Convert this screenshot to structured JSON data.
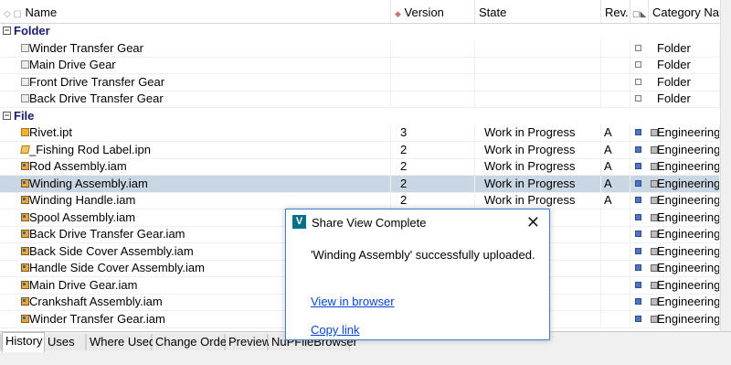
{
  "columns": {
    "name": "Name",
    "version": "Version",
    "state": "State",
    "rev": "Rev...",
    "category": "Category Nam"
  },
  "groups": [
    {
      "label": "Folder",
      "rows": [
        {
          "icon": "folder-icon",
          "name": "Winder Transfer Gear",
          "version": "",
          "state": "",
          "rev": "",
          "category": "Folder"
        },
        {
          "icon": "folder-icon",
          "name": "Main Drive Gear",
          "version": "",
          "state": "",
          "rev": "",
          "category": "Folder"
        },
        {
          "icon": "folder-icon",
          "name": "Front Drive Transfer Gear",
          "version": "",
          "state": "",
          "rev": "",
          "category": "Folder"
        },
        {
          "icon": "folder-icon",
          "name": "Back Drive Transfer Gear",
          "version": "",
          "state": "",
          "rev": "",
          "category": "Folder"
        }
      ]
    },
    {
      "label": "File",
      "rows": [
        {
          "icon": "part-file-icon",
          "name": "Rivet.ipt",
          "version": "3",
          "state": "Work in Progress",
          "rev": "A",
          "category": "Engineering"
        },
        {
          "icon": "presentation-file-icon",
          "name": "_Fishing Rod Label.ipn",
          "version": "2",
          "state": "Work in Progress",
          "rev": "A",
          "category": "Engineering"
        },
        {
          "icon": "assembly-file-icon",
          "name": "Rod Assembly.iam",
          "version": "2",
          "state": "Work in Progress",
          "rev": "A",
          "category": "Engineering"
        },
        {
          "icon": "assembly-file-icon",
          "name": "Winding Assembly.iam",
          "version": "2",
          "state": "Work in Progress",
          "rev": "A",
          "category": "Engineering",
          "selected": true
        },
        {
          "icon": "assembly-file-icon",
          "name": "Winding Handle.iam",
          "version": "2",
          "state": "Work in Progress",
          "rev": "A",
          "category": "Engineering"
        },
        {
          "icon": "assembly-file-icon",
          "name": "Spool Assembly.iam",
          "version": "",
          "state": "",
          "rev": "",
          "category": "Engineering"
        },
        {
          "icon": "assembly-file-icon",
          "name": "Back Drive Transfer Gear.iam",
          "version": "",
          "state": "",
          "rev": "",
          "category": "Engineering"
        },
        {
          "icon": "assembly-file-icon",
          "name": "Back Side Cover Assembly.iam",
          "version": "",
          "state": "",
          "rev": "",
          "category": "Engineering"
        },
        {
          "icon": "assembly-file-icon",
          "name": "Handle Side Cover Assembly.iam",
          "version": "",
          "state": "",
          "rev": "",
          "category": "Engineering"
        },
        {
          "icon": "assembly-file-icon",
          "name": "Main Drive Gear.iam",
          "version": "",
          "state": "",
          "rev": "",
          "category": "Engineering"
        },
        {
          "icon": "assembly-file-icon",
          "name": "Crankshaft Assembly.iam",
          "version": "",
          "state": "",
          "rev": "",
          "category": "Engineering"
        },
        {
          "icon": "assembly-file-icon",
          "name": "Winder Transfer Gear.iam",
          "version": "",
          "state": "",
          "rev": "",
          "category": "Engineering"
        }
      ]
    }
  ],
  "tabs": [
    "History",
    "Uses",
    "Where Used",
    "Change Order",
    "Preview",
    "NuPFileBrowser"
  ],
  "active_tab": "History",
  "dialog": {
    "title": "Share View Complete",
    "logo_letter": "V",
    "message": "'Winding Assembly' successfully uploaded.",
    "view_link": "View in browser",
    "copy_link": "Copy link",
    "close_glyph": "✕"
  },
  "colors": {
    "selected_row": "#c9d6e3",
    "group_header_text": "#1a1a6e",
    "link": "#0645d8",
    "dialog_border": "#3c7fd6"
  }
}
